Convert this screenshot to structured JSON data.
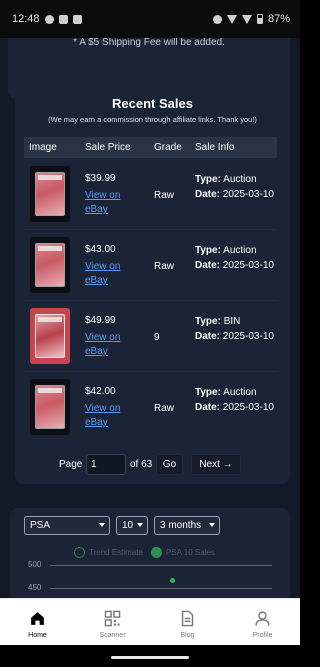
{
  "status_bar": {
    "time": "12:48",
    "battery": "87%"
  },
  "shipping": {
    "note": "* A $5 Shipping Fee will be added."
  },
  "recent_sales": {
    "title": "Recent Sales",
    "affiliate_note": "(We may earn a commission through affiliate links. Thank you!)",
    "columns": {
      "image": "Image",
      "price": "Sale Price",
      "grade": "Grade",
      "info": "Sale Info"
    },
    "type_label": "Type:",
    "date_label": "Date:",
    "rows": [
      {
        "price": "$39.99",
        "link": "View on eBay",
        "grade": "Raw",
        "type": "Auction",
        "date": "2025-03-10"
      },
      {
        "price": "$43.00",
        "link": "View on eBay",
        "grade": "Raw",
        "type": "Auction",
        "date": "2025-03-10"
      },
      {
        "price": "$49.99",
        "link": "View on eBay",
        "grade": "9",
        "type": "BIN",
        "date": "2025-03-10"
      },
      {
        "price": "$42.00",
        "link": "View on eBay",
        "grade": "Raw",
        "type": "Auction",
        "date": "2025-03-10"
      }
    ]
  },
  "pagination": {
    "label": "Page",
    "value": "1",
    "of_text": "of 63",
    "go": "Go",
    "next": "Next →"
  },
  "chart_controls": {
    "grader": "PSA",
    "grade": "10",
    "range": "3 months",
    "legend": [
      "Trend Estimate",
      "PSA 10 Sales"
    ],
    "y_ticks": [
      "500",
      "450"
    ]
  },
  "chart_data": {
    "type": "scatter",
    "series": [
      {
        "name": "PSA 10 Sales"
      }
    ],
    "legend": [
      "Trend Estimate",
      "PSA 10 Sales"
    ],
    "y_ticks": [
      500,
      450
    ]
  },
  "bottom_nav": [
    {
      "label": "Home",
      "icon": "home-icon",
      "active": true
    },
    {
      "label": "Scanner",
      "icon": "qr-code-icon",
      "active": false
    },
    {
      "label": "Blog",
      "icon": "document-icon",
      "active": false
    },
    {
      "label": "Profile",
      "icon": "person-icon",
      "active": false
    }
  ],
  "colors": {
    "background": "#121a28",
    "card": "#1a2436",
    "link": "#5b9bf2",
    "accent_green": "#2f8f52"
  }
}
